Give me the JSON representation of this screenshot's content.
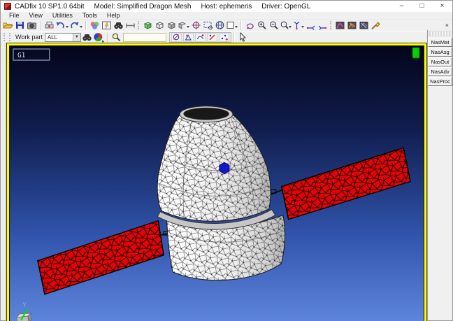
{
  "window": {
    "app_title": "CADfix 10 SP1.0 64bit",
    "model_label": "Model: Simplified Dragon Mesh",
    "host_label": "Host: ephemeris",
    "driver_label": "Driver: OpenGL"
  },
  "glyphs": {
    "minimize": "–",
    "maximize": "□",
    "close": "×",
    "small_close": "×",
    "caret_down": "▼"
  },
  "menu": {
    "items": [
      "File",
      "View",
      "Utilities",
      "Tools",
      "Help"
    ]
  },
  "toolbar1": {
    "icons": [
      "open-file",
      "save",
      "snapshot",
      "print",
      "undo",
      "redo",
      "palette",
      "flash-window",
      "find",
      "measure",
      "view-cube-shaded-green",
      "view-cube-wireframe",
      "view-cube-shaded",
      "view-cube-menu",
      "center-view",
      "zoom-window",
      "globe-view",
      "background-select",
      "rotate-view",
      "zoom-in",
      "zoom-out",
      "zoom-menu",
      "axis-main",
      "axis-alt-1",
      "axis-alt-2",
      "check-mesh-1",
      "check-mesh-2",
      "check-mesh-3",
      "paint-entities"
    ]
  },
  "toolbar2": {
    "work_part_label": "Work part",
    "work_part_value": "ALL",
    "search_value": "",
    "filter_toggles": [
      "filter-surfaces",
      "filter-wires",
      "filter-edges",
      "filter-lines",
      "filter-points"
    ]
  },
  "right_panel": {
    "buttons": [
      "NasMat",
      "NasAsg",
      "NasOut",
      "NasAdv",
      "NasProc"
    ]
  },
  "viewport": {
    "view_label": "G1",
    "axis_label": "Y",
    "colors": {
      "border": "#ffff00",
      "status_indicator": "#00d400",
      "background_top": "#04051a",
      "background_upper": "#101d4e",
      "background_lower": "#3053ab",
      "background_bottom": "#5e86dc",
      "capsule": "#f0f0f0",
      "solar_panel": "#dd0707",
      "vertex_marker": "#1616d0",
      "axis_y": "#00dd00"
    }
  }
}
